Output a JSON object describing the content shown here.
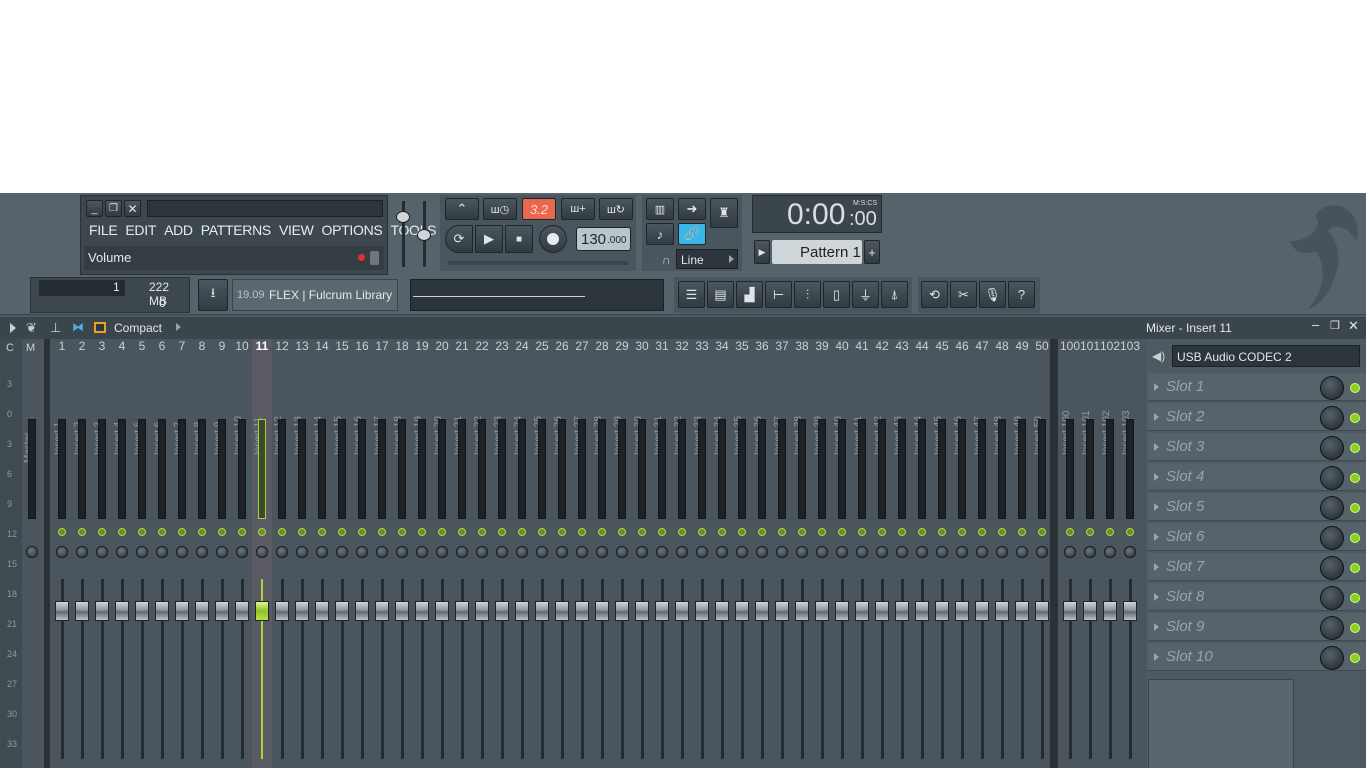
{
  "menu": {
    "items": [
      "FILE",
      "EDIT",
      "ADD",
      "PATTERNS",
      "VIEW",
      "OPTIONS",
      "TOOLS",
      "?"
    ]
  },
  "hint": {
    "label": "Volume"
  },
  "transport": {
    "tempo_main": "130",
    "tempo_dec": ".000",
    "pattern": "Pattern 1",
    "snap": "Line",
    "time_main": "0:00",
    "time_cs": ":00",
    "time_format": "M:S:CS",
    "step_mode": "3.2"
  },
  "info": {
    "cpu": "1",
    "mem": "222 MB",
    "poly": "0"
  },
  "news": {
    "time": "19.09",
    "text": "FLEX | Fulcrum Library"
  },
  "mixer": {
    "view": "Compact",
    "title": "Mixer - Insert 11",
    "device": "USB Audio CODEC  2",
    "left_cols": [
      "C",
      "M"
    ],
    "scale": [
      "3",
      "0",
      "3",
      "6",
      "9",
      "12",
      "15",
      "18",
      "21",
      "24",
      "27",
      "30",
      "33"
    ],
    "master_label": "Master",
    "insert_numbers": [
      "1",
      "2",
      "3",
      "4",
      "5",
      "6",
      "7",
      "8",
      "9",
      "10",
      "11",
      "12",
      "13",
      "14",
      "15",
      "16",
      "17",
      "18",
      "19",
      "20",
      "21",
      "22",
      "23",
      "24",
      "25",
      "26",
      "27",
      "28",
      "29",
      "30",
      "31",
      "32",
      "33",
      "34",
      "35",
      "36",
      "37",
      "38",
      "39",
      "40",
      "41",
      "42",
      "43",
      "44",
      "45",
      "46",
      "47",
      "48",
      "49",
      "50"
    ],
    "insert_names": [
      "Insert 1",
      "Insert 2",
      "Insert 3",
      "Insert 4",
      "Insert 5",
      "Insert 6",
      "Insert 7",
      "Insert 8",
      "Insert 9",
      "Insert 10",
      "Insert 11",
      "Insert 12",
      "Insert 13",
      "Insert 14",
      "Insert 15",
      "Insert 16",
      "Insert 17",
      "Insert 18",
      "Insert 19",
      "Insert 20",
      "Insert 21",
      "Insert 22",
      "Insert 23",
      "Insert 24",
      "Insert 25",
      "Insert 26",
      "Insert 27",
      "Insert 28",
      "Insert 29",
      "Insert 30",
      "Insert 31",
      "Insert 32",
      "Insert 33",
      "Insert 34",
      "Insert 35",
      "Insert 36",
      "Insert 37",
      "Insert 38",
      "Insert 39",
      "Insert 40",
      "Insert 41",
      "Insert 42",
      "Insert 43",
      "Insert 44",
      "Insert 45",
      "Insert 46",
      "Insert 47",
      "Insert 48",
      "Insert 49",
      "Insert 50"
    ],
    "extra_numbers": [
      "100",
      "101",
      "102",
      "103"
    ],
    "extra_names": [
      "Insert 100",
      "Insert 101",
      "Insert 102",
      "Insert 103"
    ],
    "selected_insert": "11",
    "slots": [
      "Slot 1",
      "Slot 2",
      "Slot 3",
      "Slot 4",
      "Slot 5",
      "Slot 6",
      "Slot 7",
      "Slot 8",
      "Slot 9",
      "Slot 10"
    ]
  },
  "colors": {
    "accent": "#a8d23a",
    "background": "#4f5b64",
    "step_active": "#e8684f",
    "link_active": "#39b8e8"
  }
}
